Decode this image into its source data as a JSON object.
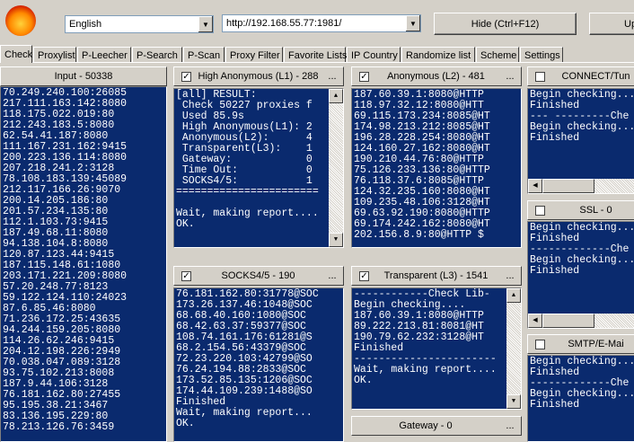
{
  "toolbar": {
    "language": "English",
    "url": "http://192.168.55.77:1981/",
    "hide_label": "Hide (Ctrl+F12)",
    "update_label": "Up"
  },
  "tabs": [
    "Check",
    "Proxylist",
    "P-Leecher",
    "P-Search",
    "P-Scan",
    "Proxy Filter",
    "Favorite Lists",
    "IP Country",
    "Randomize list",
    "Scheme",
    "Settings"
  ],
  "input_pane": {
    "title": "Input - 50338",
    "lines": [
      "70.249.240.100:26085",
      "217.111.163.142:8080",
      "118.175.022.019:80",
      "212.243.183.5:8080",
      "62.54.41.187:8080",
      "111.167.231.162:9415",
      "200.223.136.114:8080",
      "207.218.241.2:3128",
      "78.108.183.139:45089",
      "212.117.166.26:9070",
      "200.14.205.186:80",
      "201.57.234.135:80",
      "112.1.103.73:9415",
      "187.49.68.11:8080",
      "94.138.104.8:8080",
      "120.87.123.44:9415",
      "187.115.148.61:1080",
      "203.171.221.209:8080",
      "57.20.248.77:8123",
      "59.122.124.110:24023",
      "87.6.85.46:8080",
      "71.236.172.25:43635",
      "94.244.159.205:8080",
      "114.26.62.246:9415",
      "204.12.198.226:2949",
      "70.038.047.089:3128",
      "93.75.102.213:8008",
      "187.9.44.106:3128",
      "76.181.162.80:27455",
      "95.195.38.21:3467",
      "83.136.195.229:80",
      "78.213.126.76:3459"
    ]
  },
  "high_anon": {
    "title": "High Anonymous (L1) - 288",
    "dots": "...",
    "lines": [
      "[all] RESULT:",
      " Check 50227 proxies f",
      " Used 85.9s",
      " High Anonymous(L1): 2",
      " Anonymous(L2):      4",
      " Transparent(L3):    1",
      " Gateway:            0",
      " Time Out:           0",
      " SOCKS4/5:           1",
      "=======================",
      "",
      "Wait, making report....",
      "OK."
    ]
  },
  "anon": {
    "title": "Anonymous (L2) - 481",
    "dots": "...",
    "lines": [
      "187.60.39.1:8080@HTTP",
      "118.97.32.12:8080@HTT",
      "69.115.173.234:8085@HT",
      "174.98.213.212:8085@HT",
      "196.28.228.254:8080@HT",
      "124.160.27.162:8080@HT",
      "190.210.44.76:80@HTTP",
      "75.126.233.136:80@HTTP",
      "76.118.37.6:8085@HTTP",
      "124.32.235.160:8080@HT",
      "109.235.48.106:3128@HT",
      "69.63.92.190:8080@HTTP",
      "69.174.242.162:8080@HT",
      "202.156.8.9:80@HTTP $"
    ]
  },
  "connect": {
    "title": "CONNECT/Tun",
    "lines": [
      "Begin checking...",
      "Finished",
      "--- ---------Che",
      "Begin checking...",
      "Finished"
    ]
  },
  "ssl": {
    "title": "SSL - 0",
    "lines": [
      "Begin checking...",
      "Finished",
      "-------------Che",
      "Begin checking...",
      "Finished"
    ]
  },
  "smtp": {
    "title": "SMTP/E-Mai",
    "lines": [
      "Begin checking...",
      "Finished",
      "-------------Che",
      "Begin checking...",
      "Finished"
    ]
  },
  "socks": {
    "title": "SOCKS4/5 - 190",
    "dots": "...",
    "lines": [
      "76.181.162.80:31778@SOC",
      "173.26.137.46:1048@SOC",
      "68.68.40.160:1080@SOC",
      "68.42.63.37:59377@SOC",
      "108.74.161.176:61281@S",
      "68.2.154.56:43379@SOC",
      "72.23.220.103:42799@SO",
      "76.24.194.88:2833@SOC",
      "173.52.85.135:1206@SOC",
      "174.44.109.239:1488@SO",
      "Finished",
      "Wait, making report...",
      "OK."
    ]
  },
  "transparent": {
    "title": "Transparent (L3) - 1541",
    "dots": "...",
    "lines": [
      "------------Check Lib-",
      "Begin checking....",
      "187.60.39.1:8080@HTTP",
      "89.222.213.81:8081@HT",
      "190.79.62.232:3128@HT",
      "Finished",
      "-----------------------",
      "Wait, making report....",
      "OK."
    ]
  },
  "gateway": {
    "title": "Gateway - 0",
    "dots": "..."
  },
  "colors": {
    "console_bg": "#0a2a6e",
    "window_bg": "#d4d0c8"
  }
}
